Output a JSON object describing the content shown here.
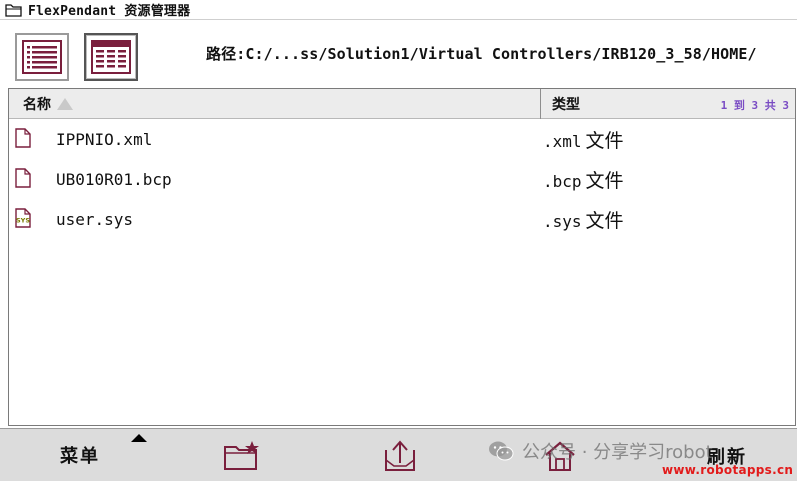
{
  "window": {
    "title": "FlexPendant 资源管理器"
  },
  "toolbar": {
    "list_view_icon": "list-view-icon",
    "detail_view_icon": "detail-view-icon",
    "path": "路径:C:/...ss/Solution1/Virtual Controllers/IRB120_3_58/HOME/"
  },
  "list": {
    "col_name": "名称",
    "col_type": "类型",
    "count": "1 到 3 共 3",
    "rows": [
      {
        "name": "IPPNIO.xml",
        "ext": ".xml",
        "kind": "文件",
        "icon": "file-icon"
      },
      {
        "name": "UB010R01.bcp",
        "ext": ".bcp",
        "kind": "文件",
        "icon": "file-icon"
      },
      {
        "name": "user.sys",
        "ext": ".sys",
        "kind": "文件",
        "icon": "sys-file-icon",
        "icon_text": "SYS"
      }
    ]
  },
  "bottom": {
    "menu_label": "菜单",
    "new_folder_icon": "new-folder-icon",
    "upload_icon": "upload-icon",
    "home_icon": "home-icon",
    "refresh_label": "刷新"
  },
  "watermark": {
    "text": "公众号 · 分享学习robot",
    "site": "www.robotapps.cn"
  },
  "colors": {
    "accent": "#7a1f3d",
    "count_text": "#7a4cc4",
    "header_bg": "#ececec",
    "bottom_bg": "#dcdcdc",
    "site_red": "#e21b1b"
  }
}
